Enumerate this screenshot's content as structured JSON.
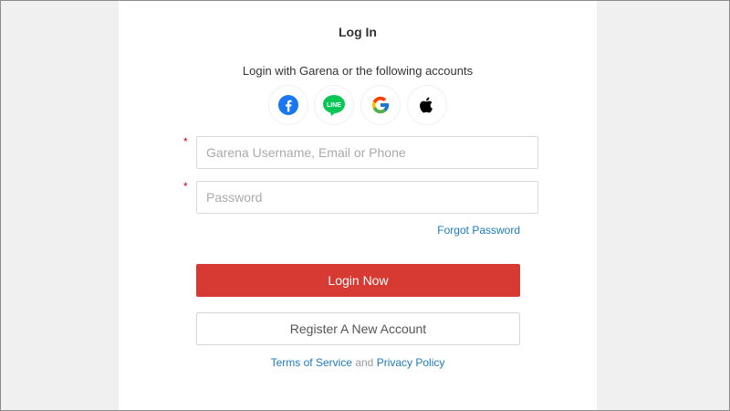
{
  "header": {
    "title": "Log In"
  },
  "social": {
    "subtitle": "Login with Garena or the following accounts",
    "providers": [
      {
        "name": "Facebook",
        "icon": "facebook-icon",
        "color": "#1877f2"
      },
      {
        "name": "LINE",
        "icon": "line-icon",
        "color": "#06c755",
        "label": "LINE"
      },
      {
        "name": "Google",
        "icon": "google-icon"
      },
      {
        "name": "Apple",
        "icon": "apple-icon",
        "color": "#000000"
      }
    ]
  },
  "form": {
    "required_mark": "*",
    "username_placeholder": "Garena Username, Email or Phone",
    "username_value": "",
    "password_placeholder": "Password",
    "password_value": "",
    "forgot_label": "Forgot Password"
  },
  "actions": {
    "login_label": "Login Now",
    "register_label": "Register A New Account",
    "login_color": "#d73a32"
  },
  "footer": {
    "terms_label": "Terms of Service",
    "and_label": "and",
    "privacy_label": "Privacy Policy",
    "link_color": "#1d7abf"
  }
}
